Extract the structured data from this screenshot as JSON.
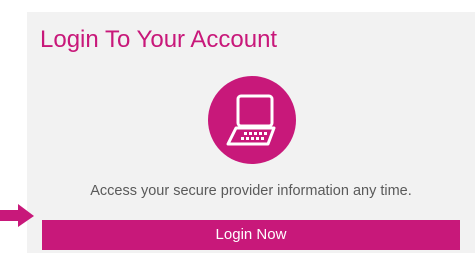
{
  "card": {
    "title": "Login To Your Account",
    "icon": "laptop-icon",
    "description": "Access your secure provider information any time.",
    "button_label": "Login Now"
  },
  "colors": {
    "accent": "#c8187a",
    "card_background": "#f2f2f2",
    "text": "#5a5a5a"
  }
}
